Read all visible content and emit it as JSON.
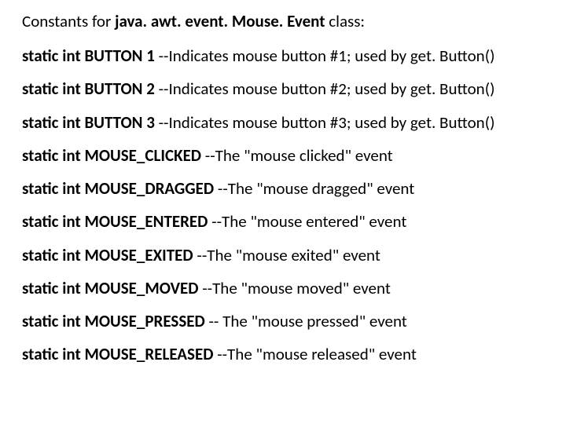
{
  "title": {
    "prefix": "Constants for ",
    "bold": "java. awt. event. Mouse. Event",
    "suffix": " class:"
  },
  "entries": [
    {
      "kw": "static int BUTTON 1",
      "desc": " --Indicates mouse button #1; used by get. Button()"
    },
    {
      "kw": "static int BUTTON 2",
      "desc": " --Indicates mouse button #2; used by get. Button()"
    },
    {
      "kw": "static int BUTTON 3",
      "desc": " --Indicates mouse button #3; used by get. Button()"
    },
    {
      "kw": "static int MOUSE_CLICKED",
      "desc": " --The \"mouse clicked\" event"
    },
    {
      "kw": "static int MOUSE_DRAGGED",
      "desc": " --The \"mouse dragged\" event"
    },
    {
      "kw": "static int MOUSE_ENTERED",
      "desc": " --The \"mouse entered\" event"
    },
    {
      "kw": "static int MOUSE_EXITED",
      "desc": " --The \"mouse exited\" event"
    },
    {
      "kw": "static int MOUSE_MOVED",
      "desc": " --The \"mouse moved\" event"
    },
    {
      "kw": "static int MOUSE_PRESSED",
      "desc": " -- The \"mouse pressed\" event"
    }
  ],
  "partial": {
    "kw": "static int MOUSE_RELEASED",
    "desc": " --The \"mouse released\" event"
  }
}
